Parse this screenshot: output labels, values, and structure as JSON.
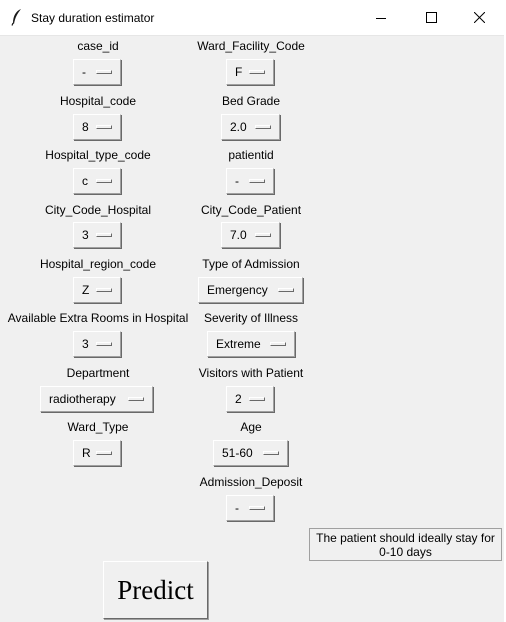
{
  "window": {
    "title": "Stay duration estimator"
  },
  "fields": [
    {
      "label": "case_id",
      "value": "-"
    },
    {
      "label": "Hospital_code",
      "value": "8"
    },
    {
      "label": "Hospital_type_code",
      "value": "c"
    },
    {
      "label": "City_Code_Hospital",
      "value": "3"
    },
    {
      "label": "Hospital_region_code",
      "value": "Z"
    },
    {
      "label": "Available Extra Rooms in Hospital",
      "value": "3"
    },
    {
      "label": "Department",
      "value": "radiotherapy"
    },
    {
      "label": "Ward_Type",
      "value": "R"
    },
    {
      "label": "Ward_Facility_Code",
      "value": "F"
    },
    {
      "label": "Bed Grade",
      "value": "2.0"
    },
    {
      "label": "patientid",
      "value": "-"
    },
    {
      "label": "City_Code_Patient",
      "value": "7.0"
    },
    {
      "label": "Type of Admission",
      "value": "Emergency"
    },
    {
      "label": "Severity of Illness",
      "value": "Extreme"
    },
    {
      "label": "Visitors with Patient",
      "value": "2"
    },
    {
      "label": "Age",
      "value": "51-60"
    },
    {
      "label": "Admission_Deposit",
      "value": "-"
    }
  ],
  "result": {
    "line1": "The patient should ideally stay for",
    "line2": "0-10 days"
  },
  "predict_button": {
    "label": "Predict"
  }
}
